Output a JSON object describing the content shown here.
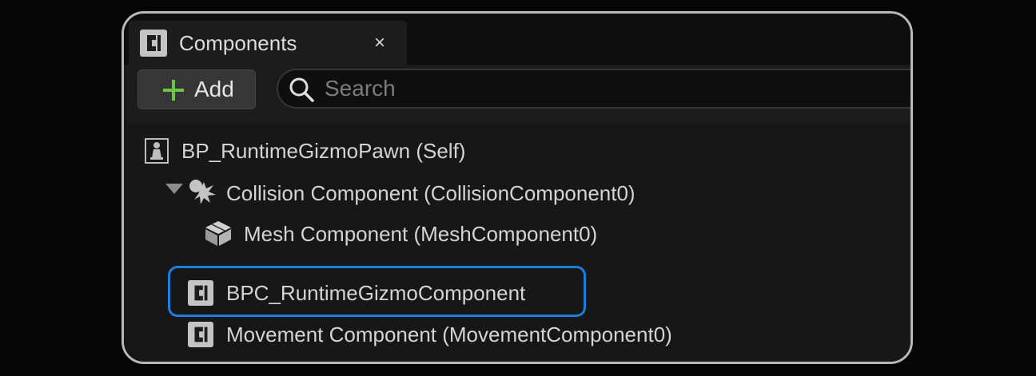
{
  "panel": {
    "tab_title": "Components",
    "close_glyph": "×",
    "tab_icon": "component-class-icon"
  },
  "toolbar": {
    "add_label": "Add",
    "add_icon": "plus-icon",
    "search_placeholder": "Search",
    "search_value": ""
  },
  "tree": {
    "items": [
      {
        "label": "BP_RuntimeGizmoPawn (Self)",
        "icon": "pawn-icon",
        "level": 0
      },
      {
        "label": "Collision Component (CollisionComponent0)",
        "icon": "collision-icon",
        "level": 0,
        "expanded": true
      },
      {
        "label": "Mesh Component (MeshComponent0)",
        "icon": "mesh-cube-icon",
        "level": 1
      },
      {
        "label": "BPC_RuntimeGizmoComponent",
        "icon": "component-class-icon",
        "level": 0,
        "highlighted": true
      },
      {
        "label": "Movement Component (MovementComponent0)",
        "icon": "component-class-icon",
        "level": 0
      }
    ]
  },
  "colors": {
    "highlight": "#1a7fe0",
    "add_plus": "#6cc644",
    "frame_border": "#b9b9b9"
  }
}
